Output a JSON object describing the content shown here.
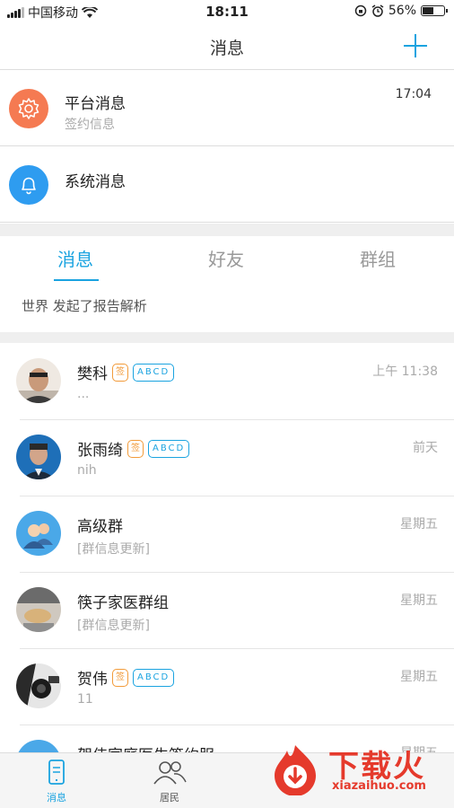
{
  "status_bar": {
    "carrier": "中国移动",
    "time": "18:11",
    "battery": "56%",
    "battery_level": 0.56
  },
  "header": {
    "title": "消息"
  },
  "notices": [
    {
      "name": "平台消息",
      "subtitle": "签约信息",
      "time": "17:04",
      "icon": "gear-icon",
      "color": "#f57a52"
    },
    {
      "name": "系统消息",
      "subtitle": "",
      "time": "",
      "icon": "bell-icon",
      "color": "#2e9cf0"
    }
  ],
  "tabs": [
    {
      "label": "消息"
    },
    {
      "label": "好友"
    },
    {
      "label": "群组"
    }
  ],
  "banner": "世界 发起了报告解析",
  "conversations": [
    {
      "name": "樊科",
      "preview": "...",
      "time": "上午 11:38",
      "sign": "签",
      "tags": "ABCD"
    },
    {
      "name": "张雨绮",
      "preview": "nih",
      "time": "前天",
      "sign": "签",
      "tags": "ABCD"
    },
    {
      "name": "高级群",
      "preview": "[群信息更新]",
      "time": "星期五"
    },
    {
      "name": "筷子家医群组",
      "preview": "[群信息更新]",
      "time": "星期五"
    },
    {
      "name": "贺伟",
      "preview": "11",
      "time": "星期五",
      "sign": "签",
      "tags": "ABCD"
    },
    {
      "name": "贺伟家庭医生签约服",
      "preview": "",
      "time": "星期五"
    }
  ],
  "tabbar": [
    {
      "label": "消息",
      "icon": "phone-icon"
    },
    {
      "label": "居民",
      "icon": "people-icon"
    }
  ],
  "watermark": {
    "cn": "下载火",
    "en": "xiazaihuo.com"
  },
  "colors": {
    "accent": "#1aa3e0",
    "sign": "#f29b3a",
    "brand_red": "#e53a2c"
  }
}
